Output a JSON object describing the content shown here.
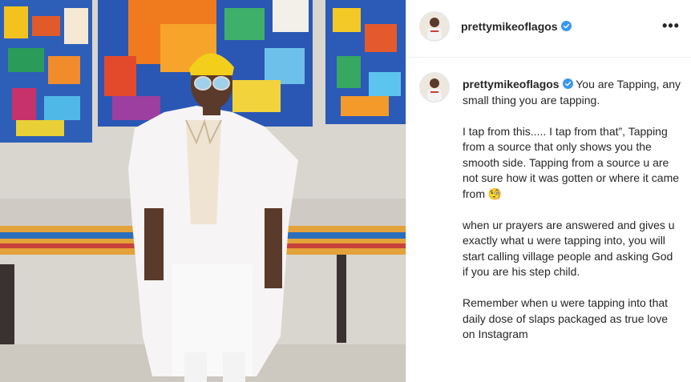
{
  "post": {
    "username": "prettymikeoflagos",
    "verified_icon": "verified-badge-icon",
    "more_icon": "more-options-icon",
    "more_label": "•••",
    "caption_username": "prettymikeoflagos",
    "caption_body": " You are Tapping, any small thing you are tapping.\n\nI tap from this..... I tap from that”, Tapping from a source that only shows you the smooth side. Tapping from a source u are not sure how it was gotten or where it came from 🧐\n\nwhen ur prayers are answered and gives u exactly what u were tapping into, you will start calling village people and asking God if you are his step child.\n\nRemember when u were tapping into that daily dose of slaps packaged as true love on Instagram"
  },
  "colors": {
    "verified": "#3897f0",
    "text": "#262626",
    "divider": "#efefef",
    "hat": "#f3cf1c"
  }
}
